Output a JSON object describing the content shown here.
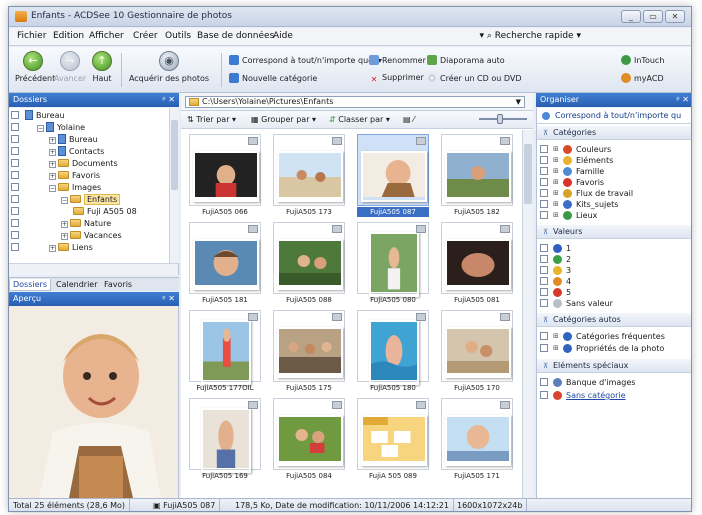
{
  "window": {
    "title": "Enfants - ACDSee 10 Gestionnaire de photos",
    "buttons": [
      "_",
      "▭",
      "✕"
    ]
  },
  "menu": {
    "items": [
      "Fichier",
      "Edition",
      "Afficher",
      "Créer",
      "Outils",
      "Base de données",
      "Aide"
    ],
    "search": "Recherche rapide"
  },
  "toolbar": {
    "precedent": "Précédent",
    "avancer": "Avancer",
    "haut": "Haut",
    "acquerir": "Acquérir des photos",
    "correspond": "Correspond à tout/n'importe quel",
    "nouvelle_categorie": "Nouvelle catégorie",
    "renommer": "Renommer",
    "supprimer": "Supprimer",
    "diaporama": "Diaporama auto",
    "cd_dvd": "Créer un CD ou DVD",
    "intouch": "InTouch",
    "myacd": "myACD"
  },
  "dossiers": {
    "header": "Dossiers",
    "tree": [
      {
        "label": "Bureau",
        "level": 0,
        "icon": "desktop"
      },
      {
        "label": "Yolaine",
        "level": 1,
        "icon": "user"
      },
      {
        "label": "Bureau",
        "level": 2,
        "icon": "doc"
      },
      {
        "label": "Contacts",
        "level": 2,
        "icon": "doc"
      },
      {
        "label": "Documents",
        "level": 2,
        "icon": "folder"
      },
      {
        "label": "Favoris",
        "level": 2,
        "icon": "folder"
      },
      {
        "label": "Images",
        "level": 2,
        "icon": "folder"
      },
      {
        "label": "Enfants",
        "level": 3,
        "icon": "folder",
        "selected": true
      },
      {
        "label": "Fuji A505 08",
        "level": 4,
        "icon": "folder"
      },
      {
        "label": "Nature",
        "level": 3,
        "icon": "folder"
      },
      {
        "label": "Vacances",
        "level": 3,
        "icon": "folder"
      },
      {
        "label": "Liens",
        "level": 2,
        "icon": "folder"
      }
    ],
    "tabs": [
      "Dossiers",
      "Calendrier",
      "Favoris"
    ]
  },
  "apercu": {
    "header": "Aperçu"
  },
  "browser": {
    "path": "C:\\Users\\Yolaine\\Pictures\\Enfants",
    "trier": "Trier par",
    "grouper": "Grouper par",
    "classer": "Classer par",
    "thumbs": [
      {
        "caption": "FujiA505 066",
        "scene": "dark",
        "selected": false
      },
      {
        "caption": "FujiA505 173",
        "scene": "beach",
        "selected": false
      },
      {
        "caption": "FujiA505 087",
        "scene": "toddler",
        "selected": true
      },
      {
        "caption": "FujiA505 182",
        "scene": "outdoor",
        "selected": false
      },
      {
        "caption": "FujiA505 181",
        "scene": "child",
        "selected": false
      },
      {
        "caption": "FujiA505 088",
        "scene": "green",
        "selected": false
      },
      {
        "caption": "FujiA505 080",
        "scene": "garden",
        "selected": false
      },
      {
        "caption": "FujiA505 081",
        "scene": "darkred",
        "selected": false
      },
      {
        "caption": "FujiA505 177OIL",
        "scene": "stand",
        "selected": false
      },
      {
        "caption": "FujiA505 175",
        "scene": "crowd",
        "selected": false
      },
      {
        "caption": "FujiA505 180",
        "scene": "pool",
        "selected": false
      },
      {
        "caption": "FujiA505 170",
        "scene": "sand",
        "selected": false
      },
      {
        "caption": "FujiA505 169",
        "scene": "portrait",
        "selected": false
      },
      {
        "caption": "FujiA505 084",
        "scene": "lawn",
        "selected": false
      },
      {
        "caption": "FujiA 505 089",
        "scene": "folder",
        "selected": false
      },
      {
        "caption": "FujiA505 171",
        "scene": "sky",
        "selected": false
      }
    ]
  },
  "organiser": {
    "header": "Organiser",
    "match": "Correspond à tout/n'importe qu",
    "categories_header": "Catégories",
    "categories": [
      {
        "label": "Couleurs",
        "color": "#d94a2b"
      },
      {
        "label": "Eléments",
        "color": "#e7b32c"
      },
      {
        "label": "Famille",
        "color": "#4c8bd6"
      },
      {
        "label": "Favoris",
        "color": "#d9342b"
      },
      {
        "label": "Flux de travail",
        "color": "#d9a32b"
      },
      {
        "label": "Kits_sujets",
        "color": "#3a6fc9"
      },
      {
        "label": "Lieux",
        "color": "#3c9a45"
      }
    ],
    "valeurs_header": "Valeurs",
    "valeurs": [
      {
        "label": "1",
        "color": "#2b5fc4"
      },
      {
        "label": "2",
        "color": "#3aa046"
      },
      {
        "label": "3",
        "color": "#e6b52a"
      },
      {
        "label": "4",
        "color": "#e38a24"
      },
      {
        "label": "5",
        "color": "#d63b2b"
      },
      {
        "label": "Sans valeur",
        "color": "#b9bfc9"
      }
    ],
    "auto_header": "Catégories autos",
    "auto": [
      {
        "label": "Catégories fréquentes",
        "color": "#2f64c1"
      },
      {
        "label": "Propriétés de la photo",
        "color": "#2f64c1"
      }
    ],
    "speciaux_header": "Eléments spéciaux",
    "speciaux": [
      {
        "label": "Banque d'images",
        "color": "#5a7fb8",
        "link": false
      },
      {
        "label": "Sans catégorie",
        "color": "#d8452f",
        "link": true
      }
    ]
  },
  "status": {
    "total": "Total 25 éléments  (28,6 Mo)",
    "file": "FujiA505 087",
    "info": "178,5 Ko, Date de modification: 10/11/2006 14:12:21",
    "dims": "1600x1072x24b"
  }
}
